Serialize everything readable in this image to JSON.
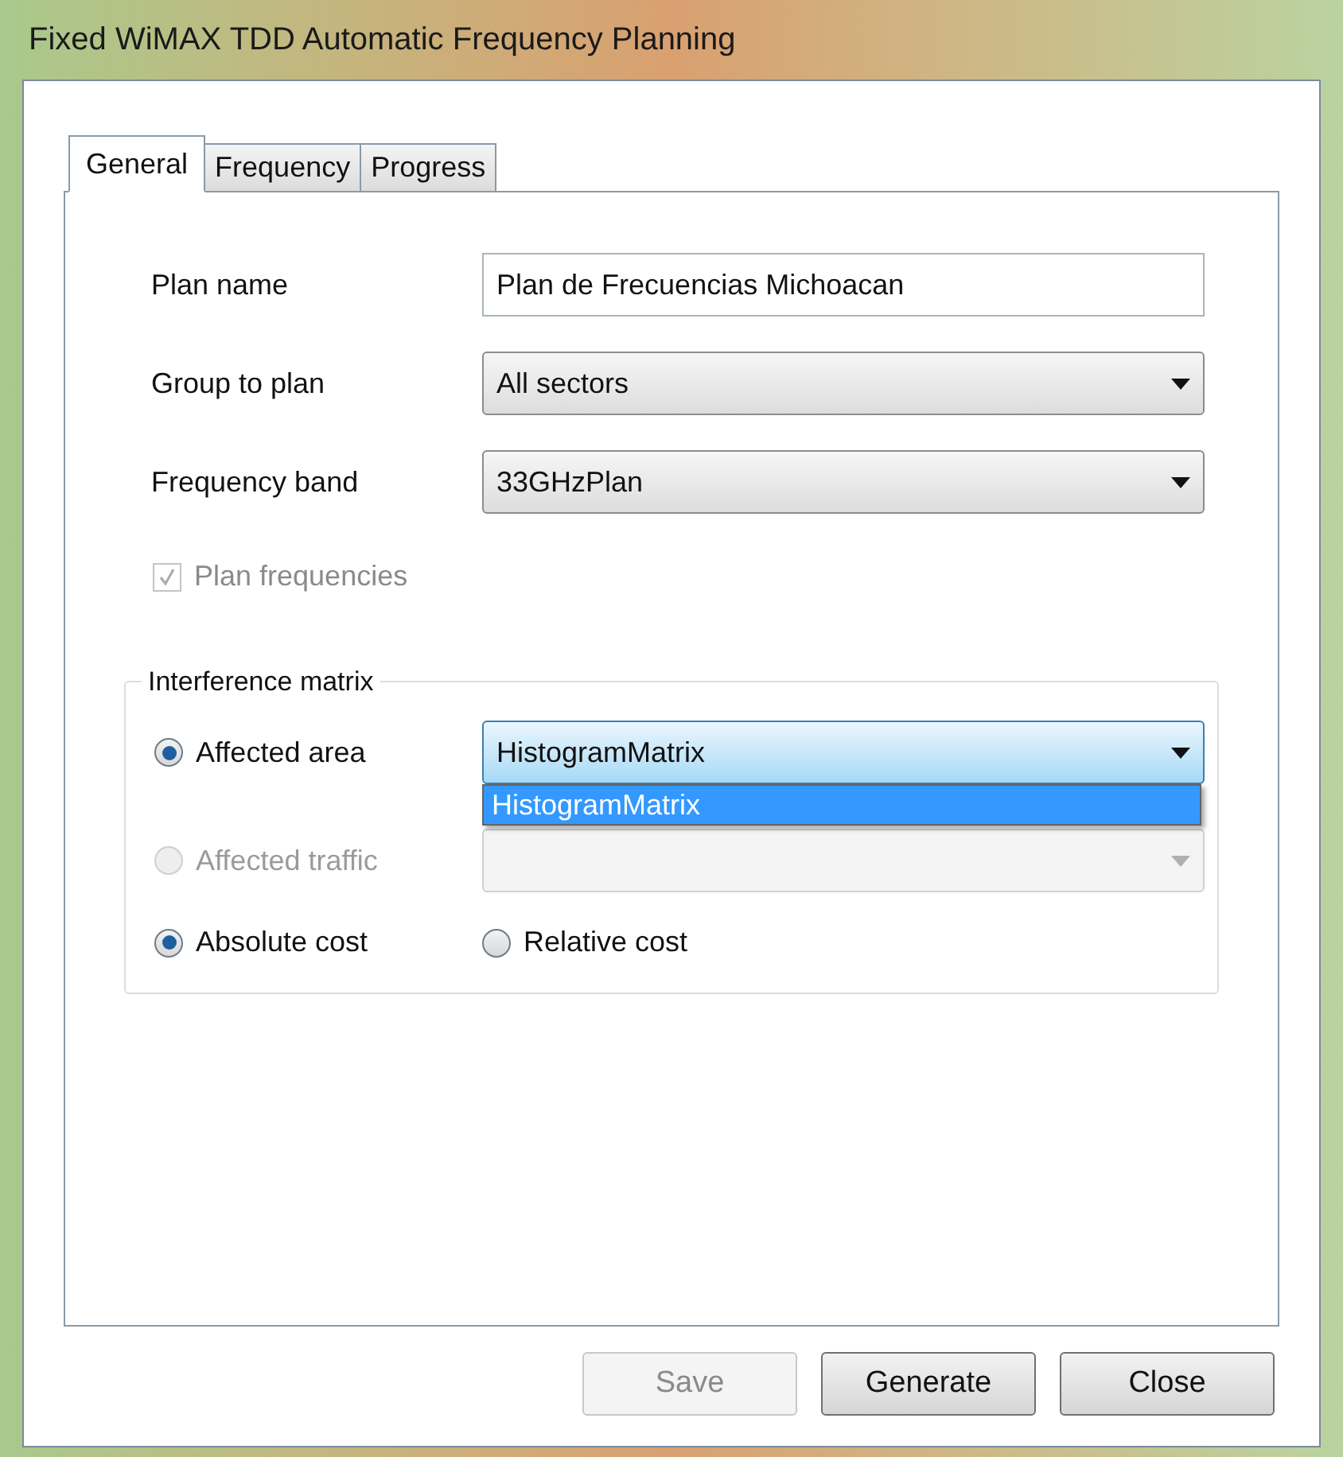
{
  "window": {
    "title": "Fixed WiMAX TDD Automatic Frequency Planning"
  },
  "tabs": [
    {
      "label": "General",
      "selected": true
    },
    {
      "label": "Frequency",
      "selected": false
    },
    {
      "label": "Progress",
      "selected": false
    }
  ],
  "fields": [
    {
      "kind": "text",
      "label": "Plan name",
      "value": "Plan de Frecuencias Michoacan"
    },
    {
      "kind": "dropdown",
      "label": "Group to plan",
      "value": "All sectors"
    },
    {
      "kind": "dropdown",
      "label": "Frequency band",
      "value": "33GHzPlan"
    }
  ],
  "plan_frequencies": {
    "label": "Plan frequencies",
    "checked": true,
    "disabled": true
  },
  "interference_matrix": {
    "title": "Interference matrix",
    "rows": [
      {
        "label": "Affected area",
        "selected": true,
        "disabled": false,
        "dropdown": {
          "value": "HistogramMatrix",
          "expanded": true,
          "disabled": false,
          "options": [
            {
              "label": "HistogramMatrix",
              "selected": true
            }
          ]
        }
      },
      {
        "label": "Affected traffic",
        "selected": false,
        "disabled": true,
        "dropdown": {
          "expanded": false,
          "disabled": true
        }
      }
    ],
    "cost": [
      {
        "label": "Absolute cost",
        "selected": true
      },
      {
        "label": "Relative cost",
        "selected": false
      }
    ]
  },
  "buttons": [
    {
      "label": "Save",
      "disabled": true
    },
    {
      "label": "Generate",
      "disabled": false
    },
    {
      "label": "Close",
      "disabled": false
    }
  ]
}
